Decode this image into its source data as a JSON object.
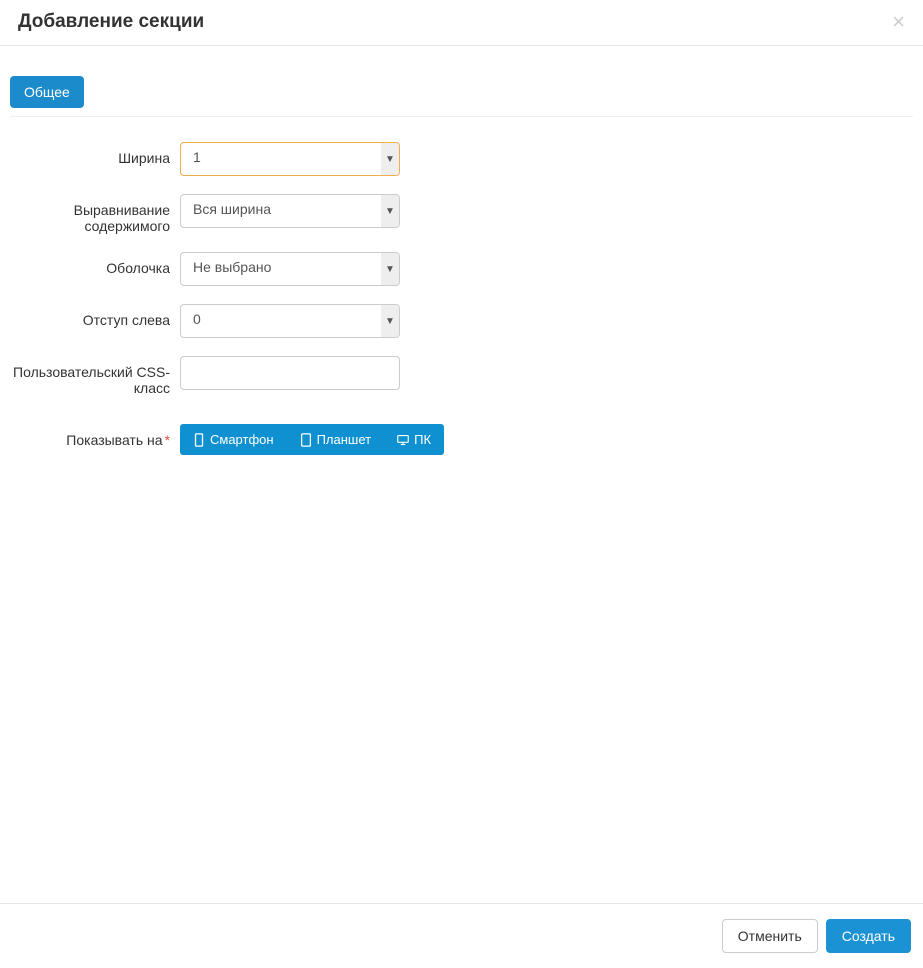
{
  "header": {
    "title": "Добавление секции"
  },
  "tabs": {
    "general": "Общее"
  },
  "form": {
    "width": {
      "label": "Ширина",
      "value": "1"
    },
    "align": {
      "label": "Выравнивание содержимого",
      "value": "Вся ширина"
    },
    "wrapper": {
      "label": "Оболочка",
      "value": "Не выбрано"
    },
    "offset": {
      "label": "Отступ слева",
      "value": "0"
    },
    "css": {
      "label": "Пользовательский CSS-класс",
      "value": ""
    },
    "show_on": {
      "label": "Показывать на",
      "devices": {
        "phone": "Смартфон",
        "tablet": "Планшет",
        "pc": "ПК"
      }
    }
  },
  "footer": {
    "cancel": "Отменить",
    "create": "Создать"
  }
}
